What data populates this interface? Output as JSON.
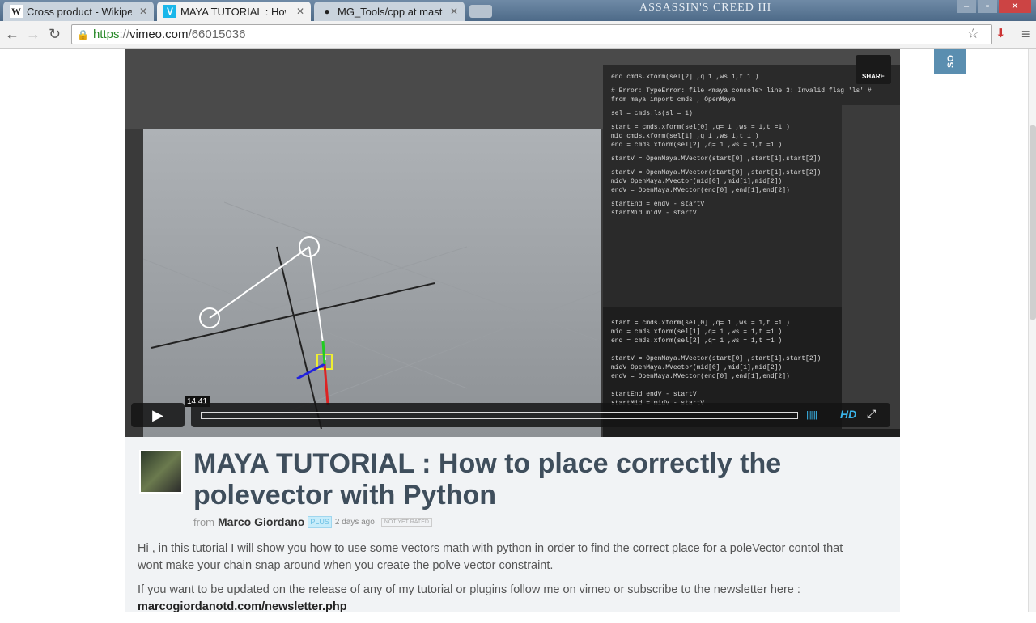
{
  "browser": {
    "tabs": [
      {
        "icon": "W",
        "title": "Cross product - Wikipedia"
      },
      {
        "icon": "V",
        "title": "MAYA TUTORIAL : How to place correctly"
      },
      {
        "icon": "●",
        "title": "MG_Tools/cpp at master"
      }
    ],
    "brand": "ASSASSIN'S CREED III",
    "url": {
      "scheme": "https",
      "sep": "://",
      "domain": "vimeo.com",
      "path": "/66015036"
    }
  },
  "video": {
    "share_label": "SHARE",
    "timestamp": "14:41",
    "hd_label": "HD",
    "progress": 0,
    "side_button": "SO",
    "code_top": [
      "end   cmds.xform(sel[2] ,q  1 ,ws   1,t  1 )",
      "# Error: TypeError: file <maya console> line 3: Invalid flag 'ls' #",
      "from maya import cmds , OpenMaya",
      "sel = cmds.ls(sl  = 1)",
      "start = cmds.xform(sel[0] ,q= 1 ,ws = 1,t =1 )",
      "mid   cmds.xform(sel[1] ,q  1 ,ws   1,t  1 )",
      "end = cmds.xform(sel[2] ,q= 1 ,ws = 1,t =1 )",
      "startV = OpenMaya.MVector(start[0] ,start[1],start[2])",
      "startV = OpenMaya.MVector(start[0] ,start[1],start[2])",
      "midV   OpenMaya.MVector(mid[0] ,mid[1],mid[2])",
      "endV = OpenMaya.MVector(end[0] ,end[1],end[2])",
      "startEnd = endV - startV",
      "startMid   midV - startV"
    ],
    "code_bottom": [
      "start = cmds.xform(sel[0] ,q= 1 ,ws = 1,t =1 )",
      "mid = cmds.xform(sel[1] ,q= 1 ,ws = 1,t =1 )",
      "end = cmds.xform(sel[2] ,q= 1 ,ws = 1,t =1 )",
      "",
      "startV = OpenMaya.MVector(start[0] ,start[1],start[2])",
      "midV   OpenMaya.MVector(mid[0] ,mid[1],mid[2])",
      "endV = OpenMaya.MVector(end[0] ,end[1],end[2])",
      "",
      "startEnd   endV - startV",
      "startMid = midV - startV"
    ]
  },
  "info": {
    "title": "MAYA TUTORIAL : How to place correctly the polevector with Python",
    "from": "from",
    "author": "Marco Giordano",
    "badge": "PLUS",
    "ago": "2 days ago",
    "rating": "NOT YET RATED",
    "desc1": "Hi , in this tutorial I will show you how to use some vectors math with python in order to find the correct place for a poleVector contol that wont make your chain snap around when you create the polve vector constraint.",
    "desc2": "If you want to be updated on the release of any of my tutorial or plugins follow me on vimeo or subscribe to the newsletter here :",
    "link": "marcogiordanotd.com/newsletter.php"
  }
}
